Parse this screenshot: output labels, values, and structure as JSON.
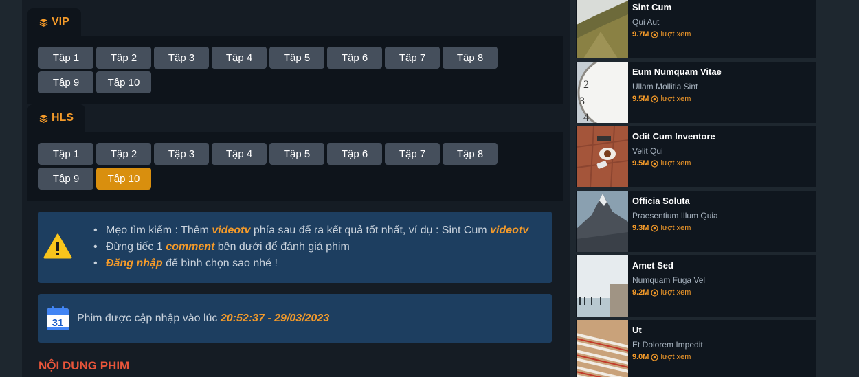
{
  "servers": [
    {
      "name": "VIP",
      "episodes": [
        "Tập 1",
        "Tập 2",
        "Tập 3",
        "Tập 4",
        "Tập 5",
        "Tập 6",
        "Tập 7",
        "Tập 8",
        "Tập 9",
        "Tập 10"
      ]
    },
    {
      "name": "HLS",
      "episodes": [
        "Tập 1",
        "Tập 2",
        "Tập 3",
        "Tập 4",
        "Tập 5",
        "Tập 6",
        "Tập 7",
        "Tập 8",
        "Tập 9",
        "Tập 10"
      ],
      "active_episode": "Tập 10"
    }
  ],
  "tips": {
    "icon": "warning-icon",
    "line1": {
      "pre": "Mẹo tìm kiếm : Thêm ",
      "em1": "videotv",
      "mid": " phía sau để ra kết quả tốt nhất, ví dụ : Sint Cum ",
      "em2": "videotv"
    },
    "line2": {
      "pre": "Đừng tiếc 1 ",
      "em": "comment",
      "post": " bên dưới để đánh giá phim"
    },
    "line3": {
      "em": "Đăng nhập",
      "post": " để bình chọn sao nhé !"
    }
  },
  "update": {
    "icon": "calendar-icon",
    "calendar_day": "31",
    "text": "Phim được cập nhập vào lúc ",
    "time": "20:52:37 - 29/03/2023"
  },
  "section_title": "NỘI DUNG PHIM",
  "colors": {
    "accent": "#f39a2a",
    "active_episode": "#d98f0e",
    "alert_bg": "#1d3e60",
    "section_title": "#e8553a"
  },
  "sidebar": {
    "views_unit": "lượt xem",
    "items": [
      {
        "title": "Sint Cum",
        "subtitle": "Qui Aut",
        "views": "9.7M"
      },
      {
        "title": "Eum Numquam Vitae",
        "subtitle": "Ullam Mollitia Sint",
        "views": "9.5M"
      },
      {
        "title": "Odit Cum Inventore",
        "subtitle": "Velit Qui",
        "views": "9.5M"
      },
      {
        "title": "Officia Soluta",
        "subtitle": "Praesentium Illum Quia",
        "views": "9.3M"
      },
      {
        "title": "Amet Sed",
        "subtitle": "Numquam Fuga Vel",
        "views": "9.2M"
      },
      {
        "title": "Ut",
        "subtitle": "Et Dolorem Impedit",
        "views": "9.0M"
      }
    ]
  }
}
